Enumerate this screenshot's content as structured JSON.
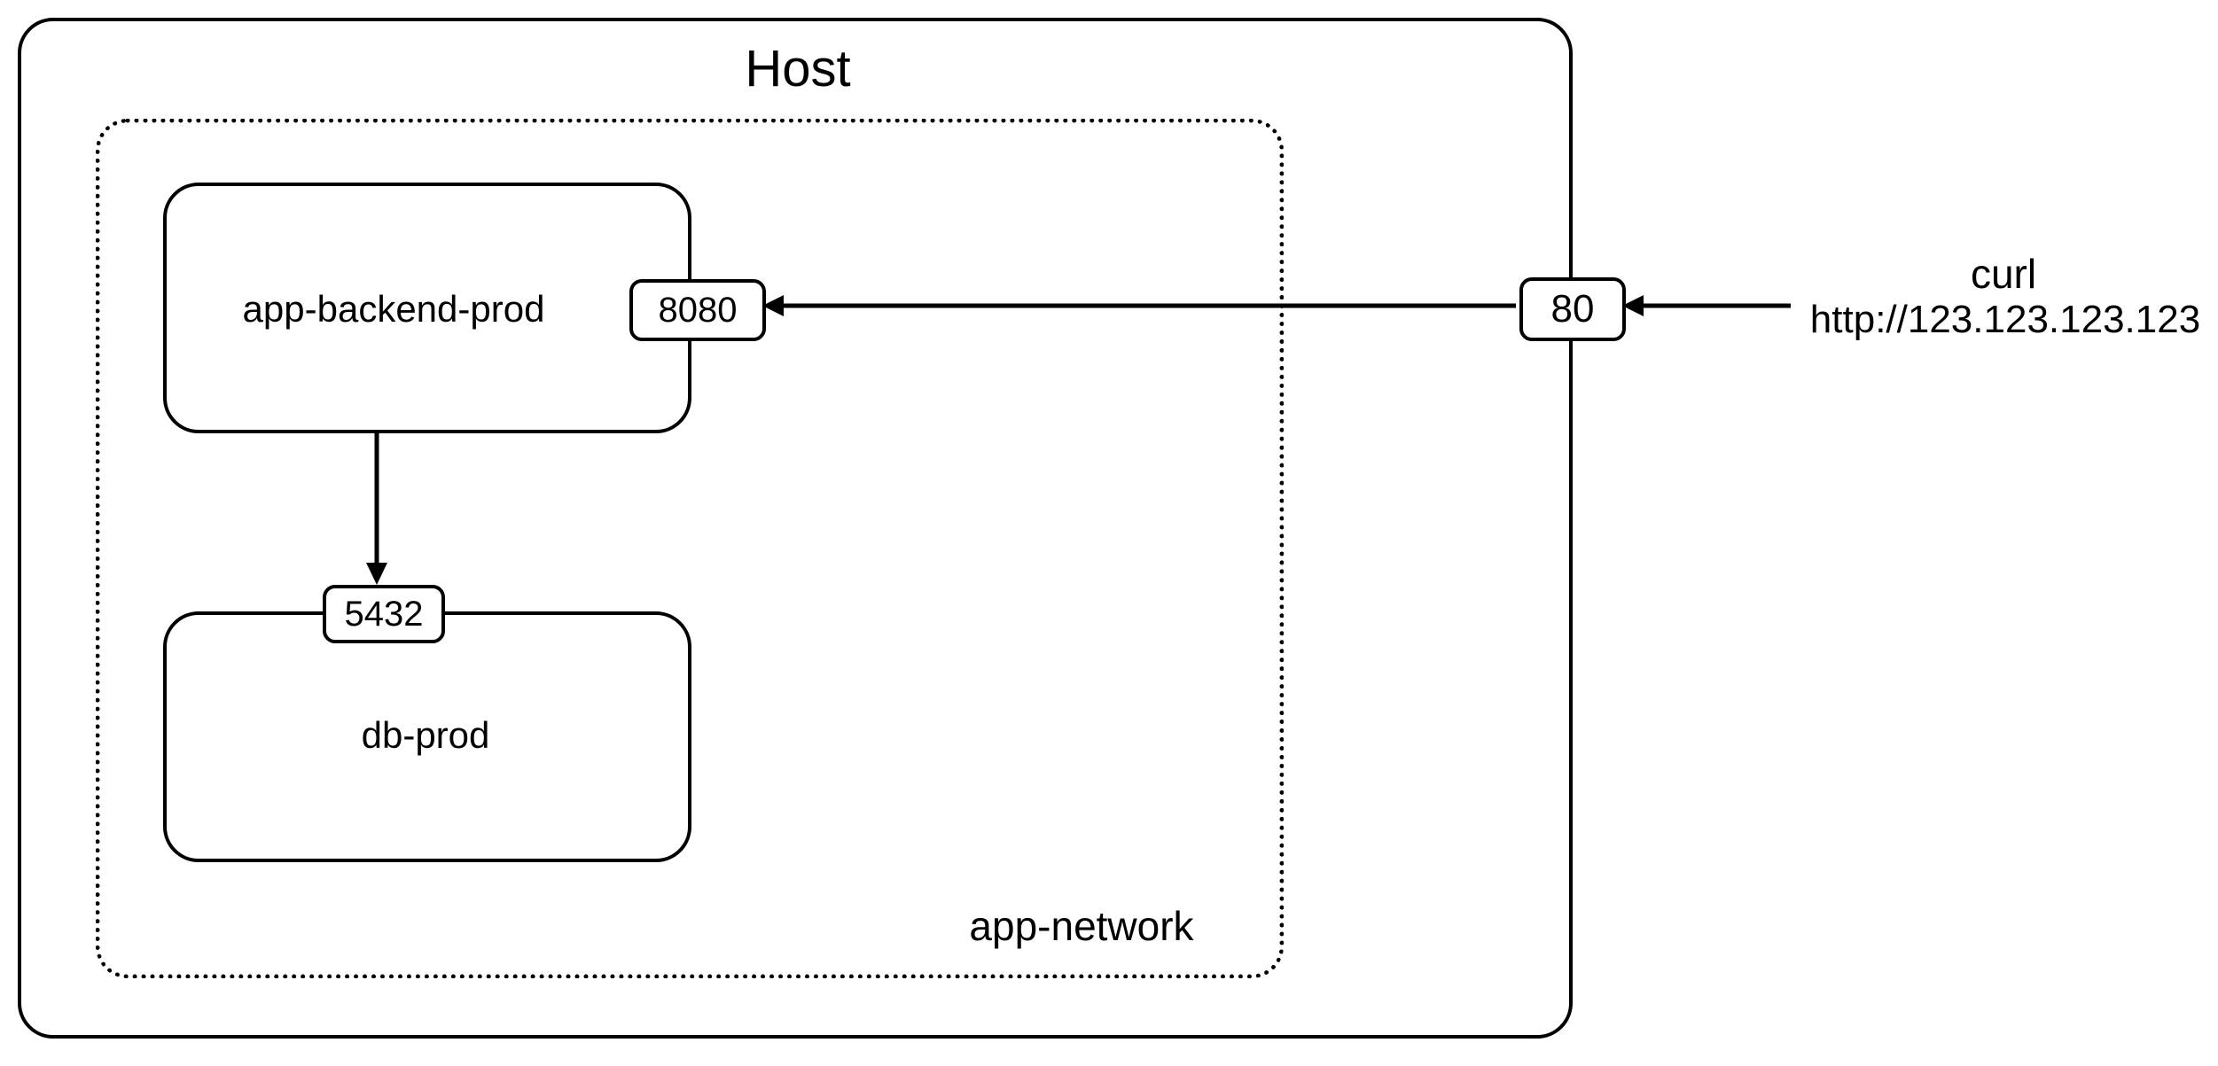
{
  "host": {
    "title": "Host"
  },
  "network": {
    "label": "app-network"
  },
  "containers": {
    "backend": {
      "name": "app-backend-prod",
      "port": "8080"
    },
    "db": {
      "name": "db-prod",
      "port": "5432"
    }
  },
  "host_port": "80",
  "client": {
    "line1": "curl",
    "line2": "http://123.123.123.123"
  }
}
